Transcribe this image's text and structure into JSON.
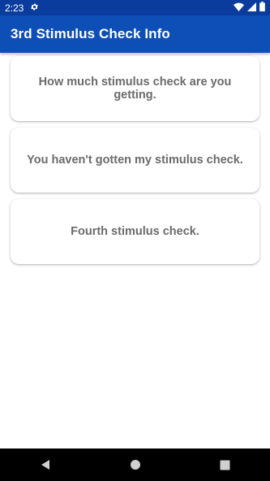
{
  "status_bar": {
    "time": "2:23",
    "icons": [
      "gear-icon",
      "wifi-icon",
      "signal-icon",
      "battery-icon"
    ]
  },
  "app_bar": {
    "title": "3rd Stimulus Check Info",
    "color": "#0d4fb6"
  },
  "cards": [
    {
      "label": "How much stimulus check are you getting."
    },
    {
      "label": "You haven't gotten my stimulus check."
    },
    {
      "label": "Fourth stimulus check."
    }
  ],
  "nav_bar": {
    "buttons": [
      "back-icon",
      "home-icon",
      "recents-icon"
    ]
  }
}
